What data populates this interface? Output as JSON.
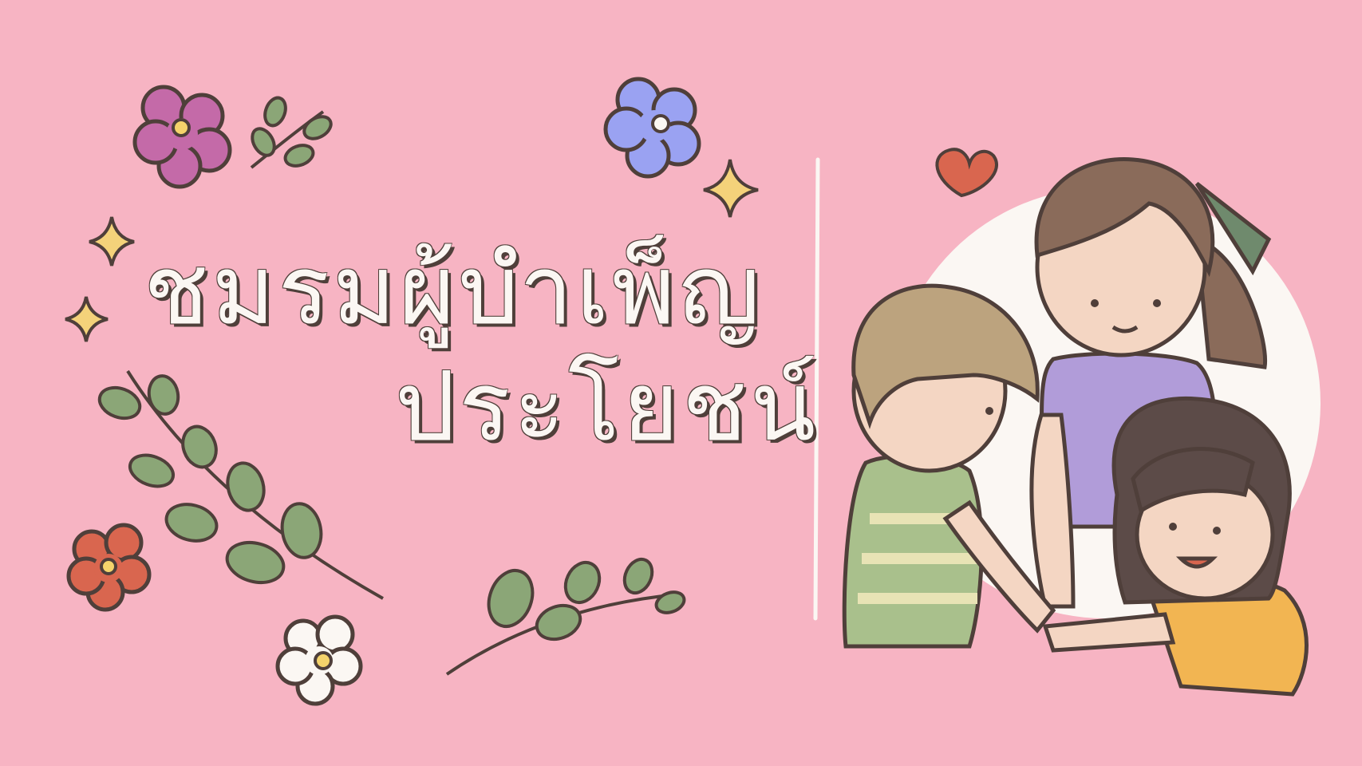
{
  "title": {
    "line1": "ชมรมผู้บำเพ็ญ",
    "line2": "ประโยชน์"
  },
  "colors": {
    "background": "#f7b4c3",
    "title_text": "#fbf7f3",
    "outline": "#4f3f3a",
    "divider": "#fbf7f3"
  },
  "decorations": [
    "flower-icon",
    "leaf-branch-icon",
    "sparkle-icon",
    "heart-icon"
  ],
  "illustration": [
    "boy",
    "girl",
    "child"
  ]
}
